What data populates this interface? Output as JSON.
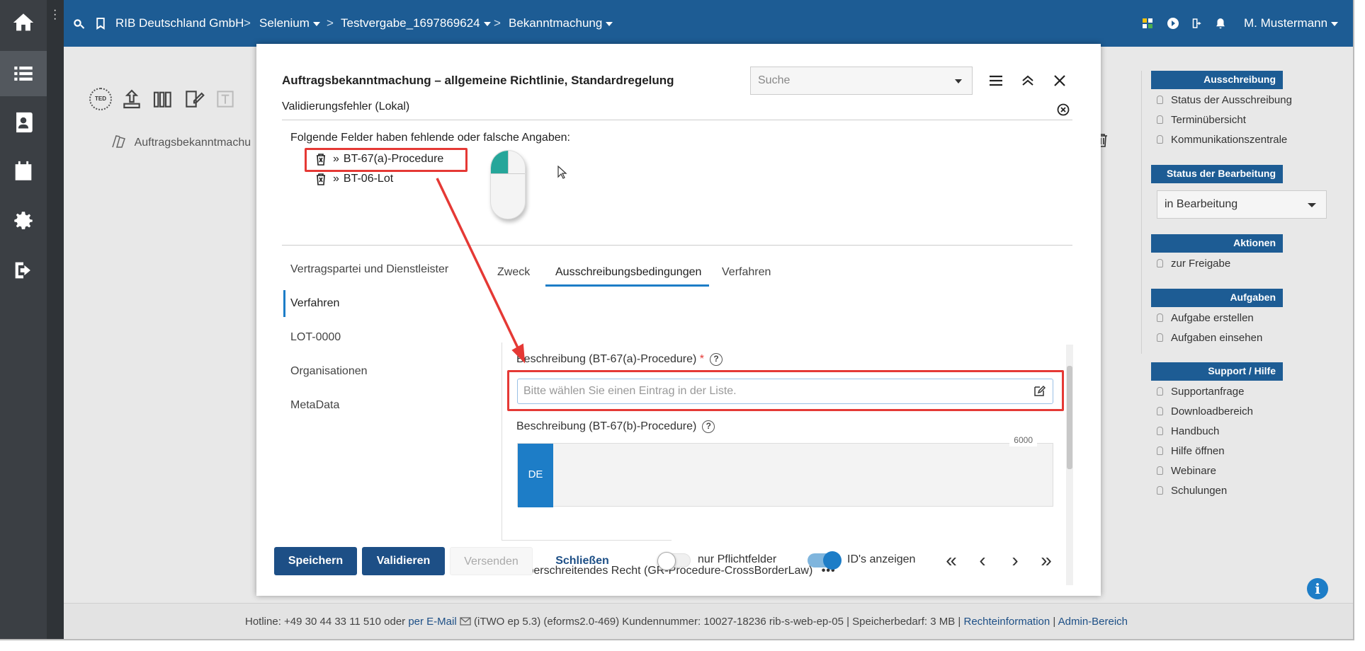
{
  "topbar": {
    "crumbs": [
      "RIB Deutschland GmbH",
      "Selenium",
      "Testvergabe_1697869624",
      "Bekanntmachung"
    ],
    "user": "M. Mustermann"
  },
  "background": {
    "doc_label": "Auftragsbekanntmachu"
  },
  "modal": {
    "title": "Auftragsbekanntmachung – allgemeine Richtlinie, Standardregelung",
    "search_placeholder": "Suche",
    "subtitle": "Validierungsfehler (Lokal)",
    "error_intro": "Folgende Felder haben fehlende oder falsche Angaben:",
    "errors": [
      {
        "label": "BT-67(a)-Procedure"
      },
      {
        "label": "BT-06-Lot"
      }
    ],
    "left_nav": [
      "Vertragspartei und Dienstleister",
      "Verfahren",
      "LOT-0000",
      "Organisationen",
      "MetaData"
    ],
    "active_nav": "Verfahren",
    "tabs": [
      "Zweck",
      "Ausschreibungsbedingungen",
      "Verfahren"
    ],
    "active_tab": "Ausschreibungsbedingungen",
    "field_a": {
      "label": "Beschreibung (BT-67(a)-Procedure)",
      "required_mark": "*",
      "placeholder": "Bitte wählen Sie einen Eintrag in der Liste."
    },
    "field_b": {
      "label": "Beschreibung (BT-67(b)-Procedure)",
      "lang": "DE",
      "counter": "6000"
    },
    "cross_border": "Grenzüberschreitendes Recht (GR-Procedure-CrossBorderLaw)",
    "buttons": {
      "save": "Speichern",
      "validate": "Validieren",
      "send": "Versenden",
      "close": "Schließen"
    },
    "toggles": {
      "required_only": {
        "label": "nur Pflichtfelder",
        "on": false
      },
      "show_ids": {
        "label": "ID's anzeigen",
        "on": true
      }
    }
  },
  "sidebar": {
    "sections": [
      {
        "title": "Ausschreibung",
        "items": [
          "Status der Ausschreibung",
          "Terminübersicht",
          "Kommunikationszentrale"
        ]
      },
      {
        "title": "Status der Bearbeitung",
        "select": "in Bearbeitung"
      },
      {
        "title": "Aktionen",
        "items": [
          "zur Freigabe"
        ]
      },
      {
        "title": "Aufgaben",
        "items": [
          "Aufgabe erstellen",
          "Aufgaben einsehen"
        ]
      },
      {
        "title": "Support / Hilfe",
        "items": [
          "Supportanfrage",
          "Downloadbereich",
          "Handbuch",
          "Hilfe öffnen",
          "Webinare",
          "Schulungen"
        ]
      }
    ]
  },
  "footer": {
    "hotline": "Hotline: +49 30 44 33 11 510 oder",
    "email_link": "per E-Mail",
    "info": "(iTWO ep 5.3) (eforms2.0-469)   Kundennummer: 10027-18236 rib-s-web-ep-05 | Speicherbedarf: 3 MB |",
    "legal_link": "Rechteinformation",
    "sep": "|",
    "admin_link": "Admin-Bereich"
  },
  "colors": {
    "topbar": "#1d5c94",
    "primary_button": "#1d4f86",
    "accent": "#1d7dc7",
    "annotation_red": "#e53935",
    "rail": "#3b3f44"
  }
}
